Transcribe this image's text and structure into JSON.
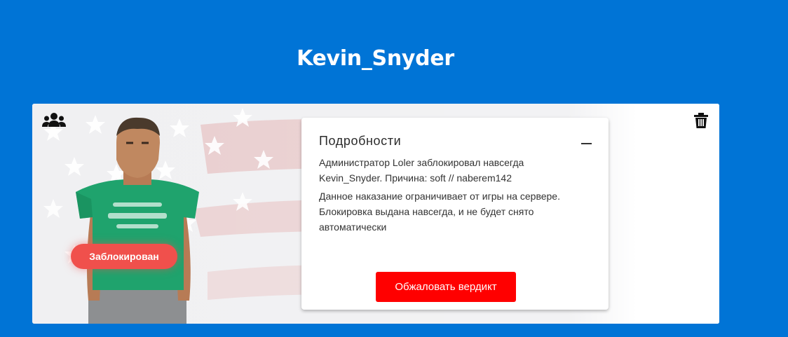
{
  "header": {
    "player_name": "Kevin_Snyder"
  },
  "card": {
    "status_badge": "Заблокирован",
    "icons": {
      "group": "group-icon",
      "trash": "trash-icon"
    },
    "details": {
      "title": "Подробности",
      "collapse_icon": "minus-icon",
      "description": "Администратор Loler заблокировал навсегда Kevin_Snyder. Причина: soft // naberem142",
      "note": "Данное наказание ограничивает от игры на сервере. Блокировка выдана навсегда, и не будет снято автоматически",
      "appeal_button": "Обжаловать вердикт"
    }
  },
  "colors": {
    "background": "#0074d6",
    "badge": "#f0504c",
    "button": "#ff0000",
    "shirt": "#1fa36d"
  }
}
